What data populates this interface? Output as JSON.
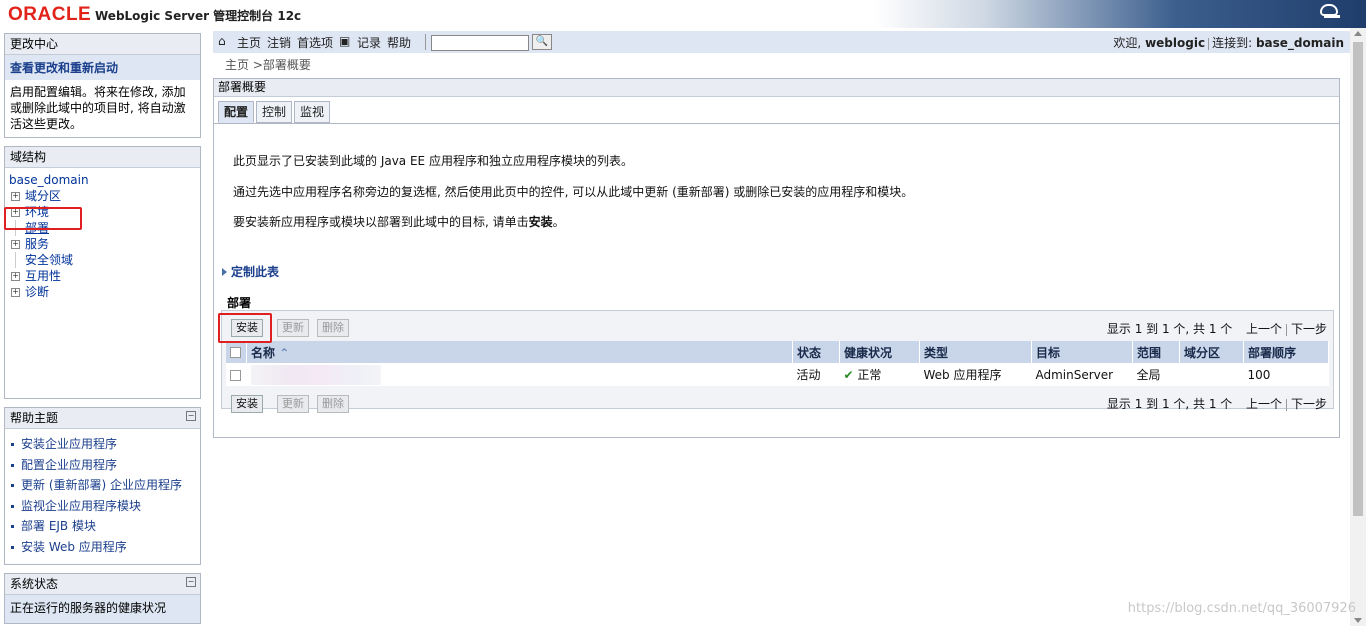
{
  "header": {
    "logo": "ORACLE",
    "product": "WebLogic Server 管理控制台 12c",
    "help_icon": "help-icon"
  },
  "change_center": {
    "title": "更改中心",
    "link": "查看更改和重新启动",
    "text": "启用配置编辑。将来在修改, 添加或删除此域中的项目时, 将自动激活这些更改。"
  },
  "domain_structure": {
    "title": "域结构",
    "root": "base_domain",
    "items": [
      {
        "label": "域分区",
        "expandable": true
      },
      {
        "label": "环境",
        "expandable": true
      },
      {
        "label": "部署",
        "expandable": false,
        "selected": true
      },
      {
        "label": "服务",
        "expandable": true
      },
      {
        "label": "安全领域",
        "expandable": false
      },
      {
        "label": "互用性",
        "expandable": true
      },
      {
        "label": "诊断",
        "expandable": true
      }
    ]
  },
  "help_topics": {
    "title": "帮助主题",
    "items": [
      "安装企业应用程序",
      "配置企业应用程序",
      "更新 (重新部署) 企业应用程序",
      "监视企业应用程序模块",
      "部署 EJB 模块",
      "安装 Web 应用程序"
    ]
  },
  "system_status": {
    "title": "系统状态",
    "text": "正在运行的服务器的健康状况"
  },
  "toolbar": {
    "home": "主页",
    "logout": "注销",
    "preferences": "首选项",
    "record": "记录",
    "help": "帮助",
    "search_placeholder": "",
    "welcome_prefix": "欢迎,",
    "user": "weblogic",
    "connected_prefix": "连接到:",
    "domain": "base_domain"
  },
  "breadcrumb": "主页 >部署概要",
  "main": {
    "title": "部署概要",
    "tabs": [
      "配置",
      "控制",
      "监视"
    ],
    "para1": "此页显示了已安装到此域的 Java EE 应用程序和独立应用程序模块的列表。",
    "para2": "通过先选中应用程序名称旁边的复选框, 然后使用此页中的控件, 可以从此域中更新 (重新部署) 或删除已安装的应用程序和模块。",
    "para3_prefix": "要安装新应用程序或模块以部署到此域中的目标, 请单击",
    "para3_bold": "安装",
    "para3_suffix": "。",
    "customize": "定制此表",
    "section_title": "部署"
  },
  "deployments": {
    "buttons": {
      "install": "安装",
      "update": "更新",
      "delete": "删除"
    },
    "pager": {
      "showing": "显示 1 到 1 个, 共 1 个",
      "prev": "上一个",
      "next": "下一步"
    },
    "columns": [
      "名称",
      "状态",
      "健康状况",
      "类型",
      "目标",
      "范围",
      "域分区",
      "部署顺序"
    ],
    "rows": [
      {
        "name": "",
        "status": "活动",
        "health": "正常",
        "type": "Web 应用程序",
        "target": "AdminServer",
        "scope": "全局",
        "partition": "",
        "order": "100"
      }
    ]
  },
  "watermark": "https://blog.csdn.net/qq_36007926",
  "colors": {
    "accent": "#1b3f8c",
    "highlight": "#e02020",
    "toolbar_bg": "#dde6f2"
  }
}
